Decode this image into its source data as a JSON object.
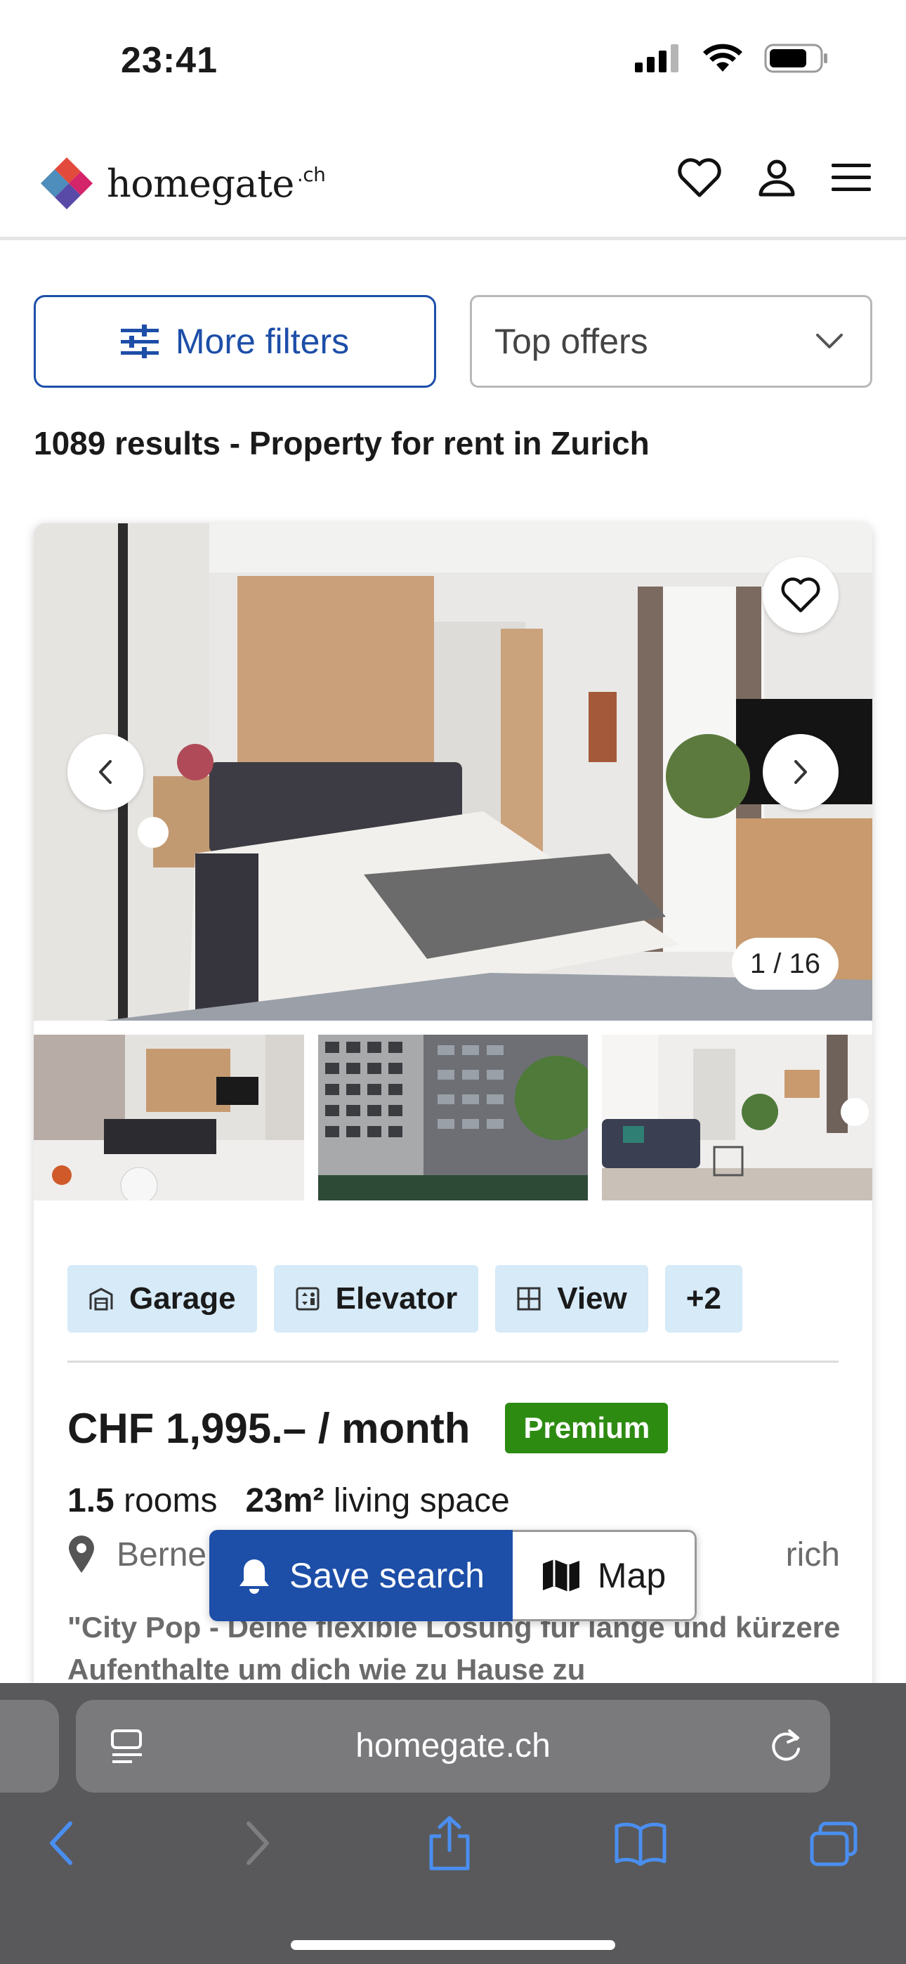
{
  "status_bar": {
    "time": "23:41"
  },
  "header": {
    "logo_text": "homegate",
    "logo_suffix": ".ch"
  },
  "filters": {
    "more_filters_label": "More filters",
    "sort_selected": "Top offers"
  },
  "results": {
    "title": "1089 results - Property for rent in Zurich"
  },
  "listing": {
    "photo_counter": "1 / 16",
    "tags": [
      {
        "label": "Garage",
        "icon": "garage-icon"
      },
      {
        "label": "Elevator",
        "icon": "elevator-icon"
      },
      {
        "label": "View",
        "icon": "view-icon"
      },
      {
        "label": "+2",
        "icon": ""
      }
    ],
    "price": "CHF 1,995.– / month",
    "badge": "Premium",
    "rooms_value": "1.5",
    "rooms_label": "rooms",
    "area_value": "23m²",
    "area_label": "living space",
    "address_start": "Berne",
    "address_end": "rich",
    "description": "\"City Pop - Deine flexible Lösung für lange und kürzere Aufenthalte um dich wie zu Hause zu"
  },
  "floating": {
    "save_search_label": "Save search",
    "map_label": "Map"
  },
  "browser": {
    "url": "homegate.ch"
  },
  "colors": {
    "brand_blue": "#1d4ea8",
    "premium_green": "#2e8b12",
    "tag_bg": "#d6eaf8"
  }
}
